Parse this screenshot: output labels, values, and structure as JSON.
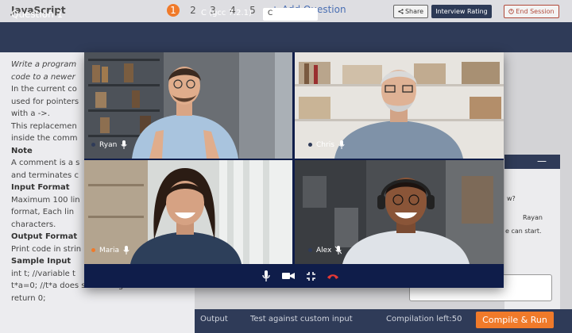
{
  "topbar": {
    "language": "JavaScript",
    "questions": [
      "1",
      "2",
      "3",
      "4",
      "5"
    ],
    "add_question": "+ Add Question",
    "share": "Share",
    "interview_rating": "Interview Rating",
    "end_session": "End Session"
  },
  "question_header": {
    "title": "Question 1",
    "compiler": "C (gcc 7.2.1)",
    "language_value": "C"
  },
  "problem": {
    "lines": [
      "Write a program",
      "code to a newer",
      "In the current co",
      "used for pointers",
      "with a ->.",
      "This replacemen",
      "inside the comm"
    ],
    "note_heading": "Note",
    "note_lines": [
      "A comment is a s",
      "and terminates c"
    ],
    "input_heading": "Input Format",
    "input_lines": [
      "Maximum 100 lin",
      "format, Each lin",
      "characters."
    ],
    "output_heading": "Output Format",
    "output_line": "Print code in strin",
    "sample_heading": "Sample Input",
    "sample_lines": [
      "int t; //variable t",
      "t*a=0;  //t*a does something",
      "return 0;"
    ]
  },
  "chat": {
    "msg1": "w?",
    "msg2": "Rayan",
    "msg3": "e can start."
  },
  "bottom": {
    "output": "Output",
    "test": "Test against custom input",
    "compilation": "Compilation left:50",
    "compile_run": "Compile & Run"
  },
  "video_call": {
    "participants": [
      {
        "name": "Ryan"
      },
      {
        "name": "Chris"
      },
      {
        "name": "Maria"
      },
      {
        "name": "Alex"
      }
    ],
    "controls": [
      "mic-icon",
      "camera-icon",
      "minimize-icon",
      "hang-up-icon"
    ],
    "colors": {
      "accent": "#f07a2a",
      "header": "#2f3b58",
      "call_bg": "#0f1d4a",
      "hangup": "#e53935"
    }
  }
}
